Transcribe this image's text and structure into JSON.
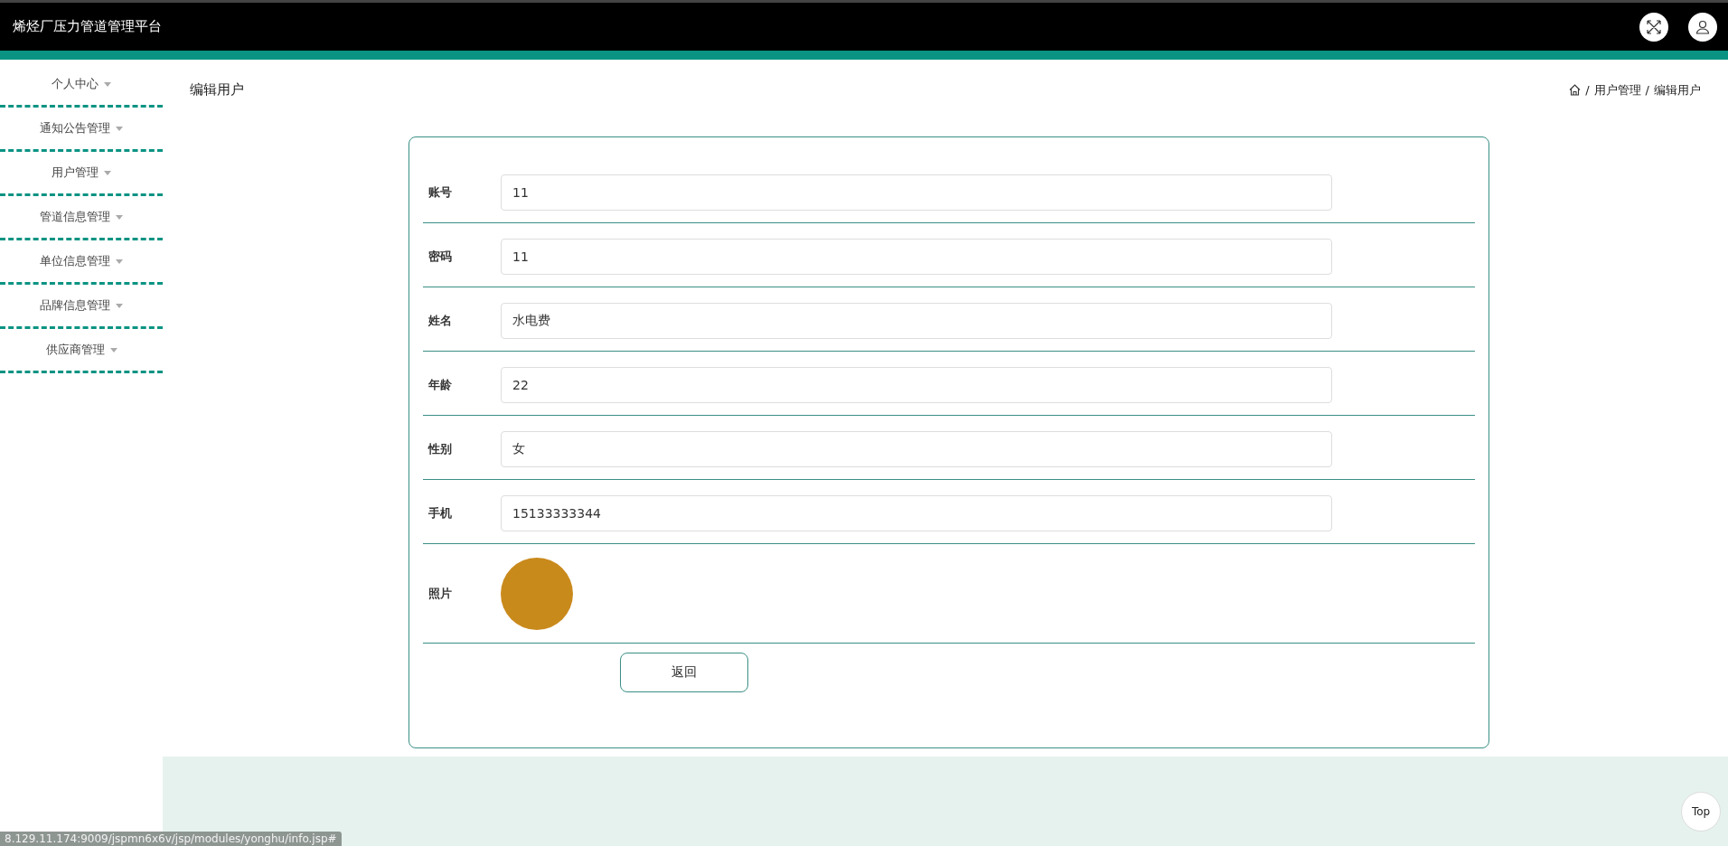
{
  "header": {
    "title": "烯烃厂压力管道管理平台"
  },
  "sidebar": {
    "items": [
      {
        "label": "个人中心"
      },
      {
        "label": "通知公告管理"
      },
      {
        "label": "用户管理"
      },
      {
        "label": "管道信息管理"
      },
      {
        "label": "单位信息管理"
      },
      {
        "label": "品牌信息管理"
      },
      {
        "label": "供应商管理"
      }
    ]
  },
  "page_title": "编辑用户",
  "breadcrumb": [
    {
      "separator": "/",
      "label": "用户管理"
    },
    {
      "separator": "/",
      "label": "编辑用户"
    }
  ],
  "form": {
    "fields": [
      {
        "kind": "text",
        "label": "账号",
        "value": "11"
      },
      {
        "kind": "text",
        "label": "密码",
        "value": "11"
      },
      {
        "kind": "text",
        "label": "姓名",
        "value": "水电费"
      },
      {
        "kind": "text",
        "label": "年龄",
        "value": "22"
      },
      {
        "kind": "text",
        "label": "性别",
        "value": "女"
      },
      {
        "kind": "text",
        "label": "手机",
        "value": "15133333344"
      },
      {
        "kind": "photo",
        "label": "照片"
      }
    ],
    "buttons": [
      "返回"
    ]
  },
  "top_button": "Top",
  "status_bar": "8.129.11.174:9009/jspmn6x6v/jsp/modules/yonghu/info.jsp#"
}
